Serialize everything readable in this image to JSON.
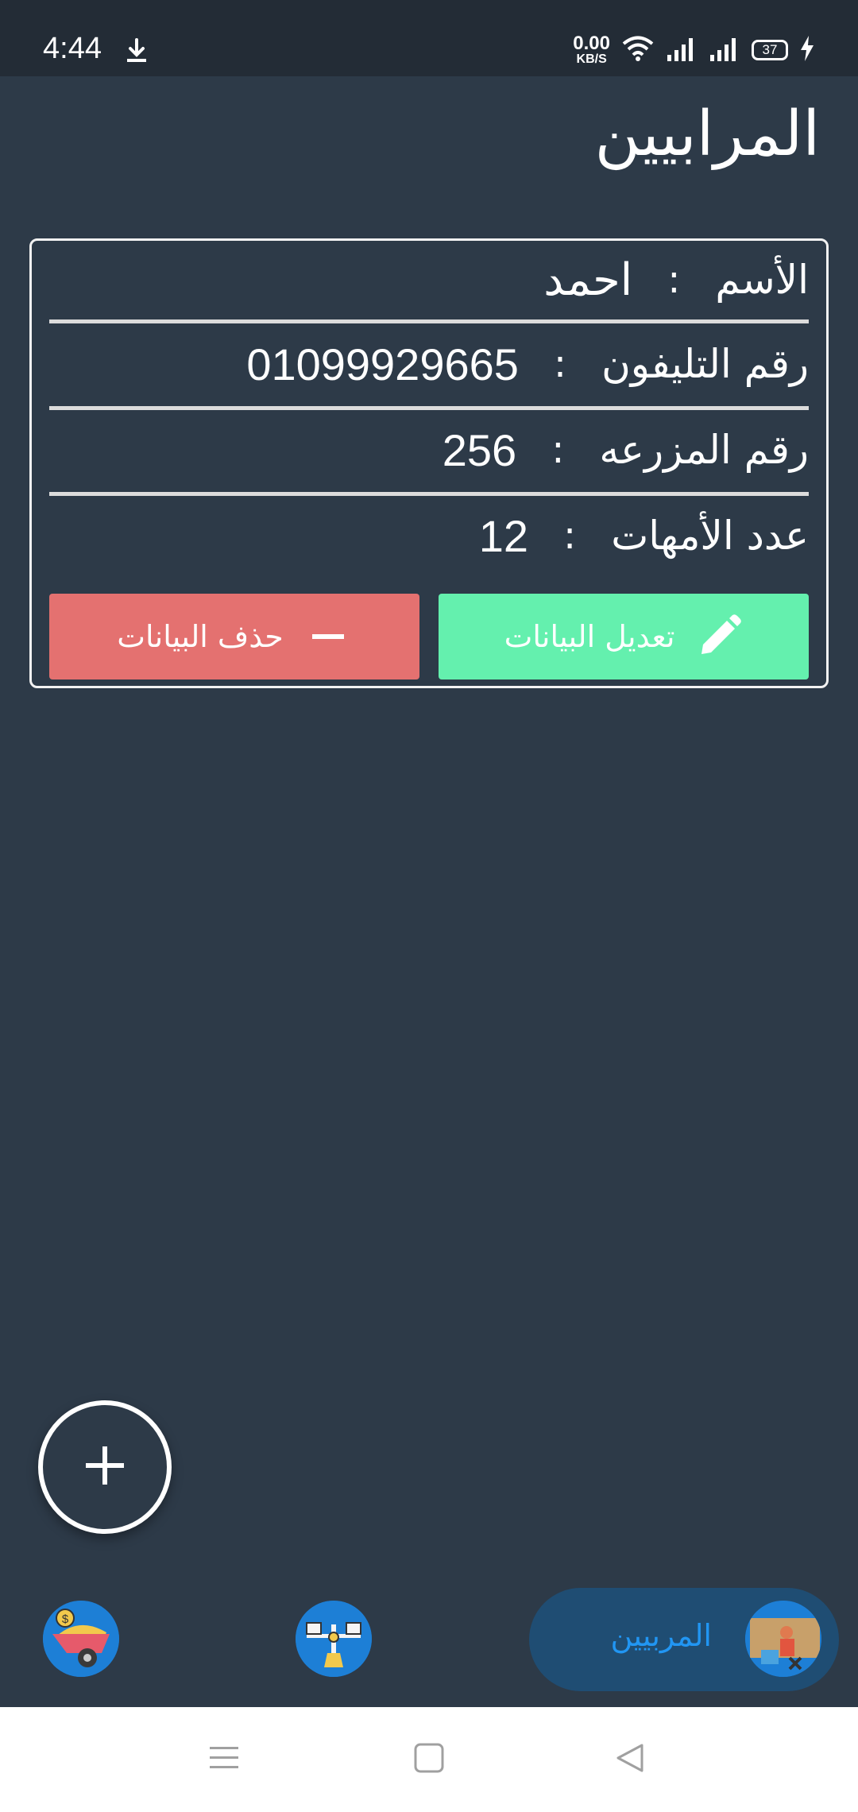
{
  "status_bar": {
    "time": "4:44",
    "net_speed_value": "0.00",
    "net_speed_unit": "KB/S",
    "battery": "37"
  },
  "page": {
    "title": "المرابيين"
  },
  "breeder_card": {
    "name_label": "الأسم",
    "name_value": "احمد",
    "phone_label": "رقم التليفون",
    "phone_value": "01099929665",
    "farm_label": "رقم المزرعه",
    "farm_value": "256",
    "mothers_label": "عدد الأمهات",
    "mothers_value": "12",
    "separator": ":",
    "edit_label": "تعديل البيانات",
    "delete_label": "حذف البيانات"
  },
  "bottom_nav": {
    "active_label": "المربيين"
  },
  "colors": {
    "background": "#2d3a48",
    "edit_button": "#64f0ae",
    "delete_button": "#e47170",
    "active_nav_text": "#2196f3"
  },
  "icons": {
    "status_download": "download-icon",
    "wifi": "wifi-icon",
    "signal": "signal-icon",
    "charging": "charging-icon",
    "edit": "pencil-icon",
    "delete": "minus-icon",
    "fab": "plus-icon",
    "nav_1": "wheelbarrow-money-icon",
    "nav_2": "balance-scale-icon",
    "nav_3": "breeder-icon",
    "sys_menu": "menu-icon",
    "sys_home": "home-square-icon",
    "sys_back": "back-triangle-icon"
  }
}
